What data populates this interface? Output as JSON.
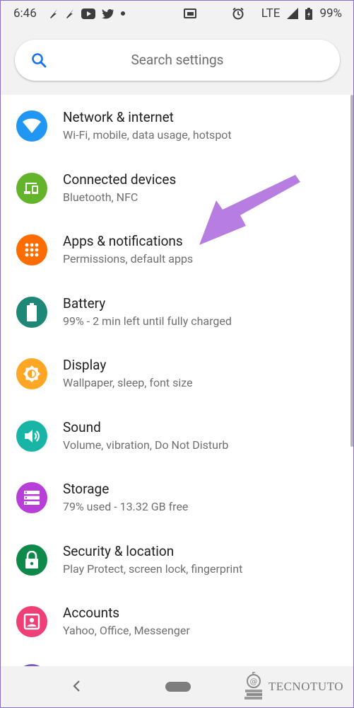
{
  "status_bar": {
    "time": "6:46",
    "network": "LTE",
    "battery": "99%",
    "notification_icons": [
      "bolt-icon",
      "bolt-icon",
      "youtube-icon",
      "twitter-icon",
      "dot-icon"
    ],
    "right_icons": [
      "cast-icon",
      "alarm-icon",
      "signal-icon",
      "battery-icon"
    ]
  },
  "search": {
    "placeholder": "Search settings"
  },
  "settings": [
    {
      "title": "Network & internet",
      "subtitle": "Wi-Fi, mobile, data usage, hotspot",
      "icon": "wifi-icon",
      "color": "#2196f3"
    },
    {
      "title": "Connected devices",
      "subtitle": "Bluetooth, NFC",
      "icon": "devices-icon",
      "color": "#64b42b"
    },
    {
      "title": "Apps & notifications",
      "subtitle": "Permissions, default apps",
      "icon": "apps-grid-icon",
      "color": "#ff6d00"
    },
    {
      "title": "Battery",
      "subtitle": "99% - 2 min left until fully charged",
      "icon": "battery-icon",
      "color": "#1e8777"
    },
    {
      "title": "Display",
      "subtitle": "Wallpaper, sleep, font size",
      "icon": "brightness-icon",
      "color": "#ffa724"
    },
    {
      "title": "Sound",
      "subtitle": "Volume, vibration, Do Not Disturb",
      "icon": "volume-icon",
      "color": "#18b5a6"
    },
    {
      "title": "Storage",
      "subtitle": "79% used - 13.32 GB free",
      "icon": "storage-icon",
      "color": "#b73fd8"
    },
    {
      "title": "Security & location",
      "subtitle": "Play Protect, screen lock, fingerprint",
      "icon": "lock-icon",
      "color": "#0d8a4a"
    },
    {
      "title": "Accounts",
      "subtitle": "Yahoo, Office, Messenger",
      "icon": "account-icon",
      "color": "#ee3f76"
    }
  ],
  "annotation": {
    "arrow_color": "#b87de0"
  },
  "watermark": {
    "text": "TECNOTUTO"
  }
}
